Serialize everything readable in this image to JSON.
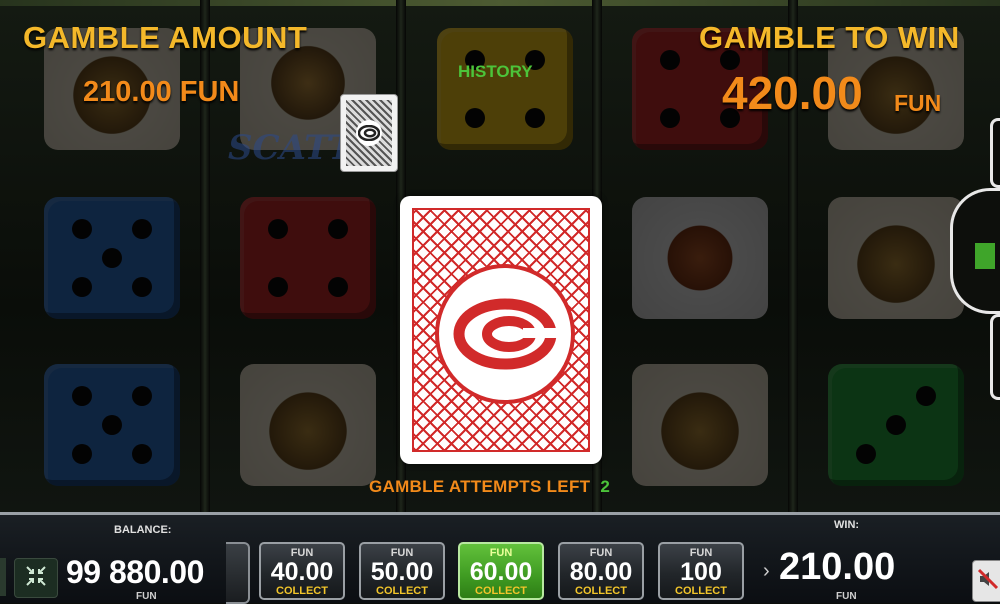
{
  "gamble": {
    "amount_label": "GAMBLE AMOUNT",
    "amount_value": "210.00 FUN",
    "to_win_label": "GAMBLE TO WIN",
    "to_win_value": "420.00",
    "to_win_currency": "FUN",
    "history_label": "HISTORY",
    "attempts_label": "GAMBLE ATTEMPTS LEFT",
    "attempts_value": "2"
  },
  "background_symbols": {
    "scatter_text": "SCATT",
    "die_colors": [
      "#2d6fc4",
      "#c42a2a",
      "#f0c419",
      "#27a33e",
      "#d8d8d8"
    ]
  },
  "bottom_bar": {
    "balance_label": "BALANCE:",
    "balance_value": "99 880.00",
    "balance_currency": "FUN",
    "win_label": "WIN:",
    "win_value": "210.00",
    "win_currency": "FUN",
    "bet_options": [
      {
        "currency": "FUN",
        "value": "40.00",
        "action": "COLLECT",
        "active": false
      },
      {
        "currency": "FUN",
        "value": "50.00",
        "action": "COLLECT",
        "active": false
      },
      {
        "currency": "FUN",
        "value": "60.00",
        "action": "COLLECT",
        "active": true
      },
      {
        "currency": "FUN",
        "value": "80.00",
        "action": "COLLECT",
        "active": false
      },
      {
        "currency": "FUN",
        "value": "100",
        "action": "COLLECT",
        "active": false
      }
    ]
  },
  "icons": {
    "fullscreen": "collapse-arrows-icon",
    "card_emblem": "swirl-logo-icon",
    "sound_off": "speaker-muted-icon"
  },
  "colors": {
    "label_yellow": "#f4b82a",
    "amount_orange": "#f28a1a",
    "history_green": "#4cc43a",
    "active_bet_green": "#3f9b22",
    "card_red": "#d12a2a"
  }
}
